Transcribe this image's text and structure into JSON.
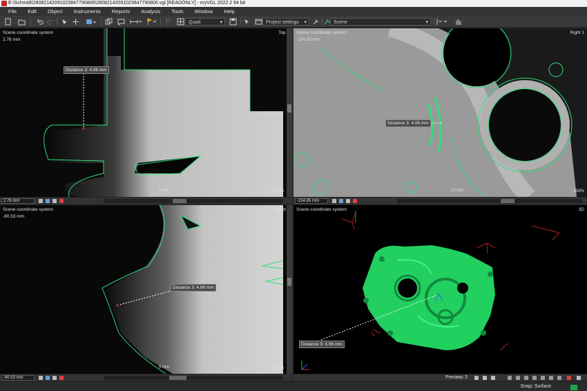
{
  "window": {
    "title": "E:\\Schmidt\\280821420910238477908​06\\28082142091023847790806.vgl [READONLY] - myVGL 2022.2 64 bit"
  },
  "menu": [
    "File",
    "Edit",
    "Object",
    "Instruments",
    "Reports",
    "Analysis",
    "Tools",
    "Window",
    "Help"
  ],
  "toolbar": {
    "layout_select": "Quad",
    "settings_select": "Project settings",
    "scene_select": "Scene"
  },
  "viewports": {
    "top": {
      "coord_label": "Scene coordinate system",
      "value": "2.76 mm",
      "name": "Top 1",
      "distance_label": "Distance 3: 4.06 mm",
      "scale": "5 mm",
      "zoom": "1776%",
      "field_value": "2.76 mm"
    },
    "right": {
      "coord_label": "Scene coordinate system",
      "value": "-154.85 mm",
      "name": "Right 1",
      "distance_label": "Distance 3: 4.06 mm",
      "scale": "10 mm",
      "zoom": "659%",
      "field_value": "-154.85 mm"
    },
    "front": {
      "coord_label": "Scene coordinate system",
      "value": "-90.53 mm",
      "name": "Front 1",
      "distance_label": "Distance 3: 4.06 mm",
      "scale": "5 mm",
      "zoom": "1318%",
      "field_value": "-90.53 mm"
    },
    "3d": {
      "coord_label": "Scene coordinate system",
      "name": "3D",
      "distance_label": "Distance 3: 4.06 mm",
      "preview_label": "Preview:",
      "preview_value": "3"
    }
  },
  "status": {
    "snap": "Snap: Surface"
  },
  "colors": {
    "accent_green": "#2ee07a",
    "selection_red": "#d23232",
    "background": "#2b2b2b"
  }
}
